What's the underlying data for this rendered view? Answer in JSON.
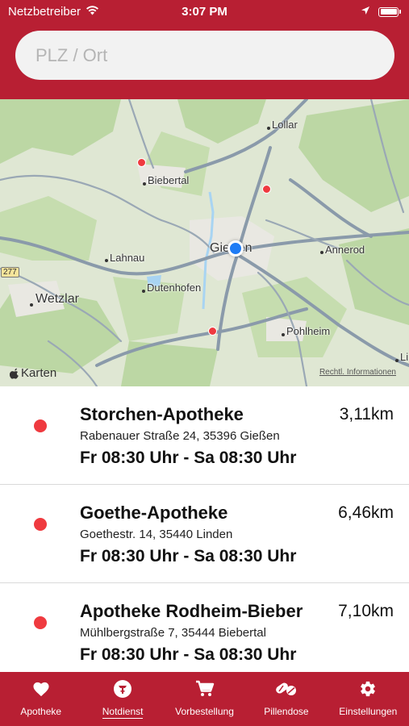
{
  "status_bar": {
    "carrier": "Netzbetreiber",
    "time": "3:07 PM"
  },
  "search": {
    "placeholder": "PLZ / Ort",
    "value": ""
  },
  "map": {
    "labels": {
      "lollar": "Lollar",
      "biebertal": "Biebertal",
      "giessen": "Gießen",
      "annerod": "Annerod",
      "lahnau": "Lahnau",
      "dutenhofen": "Dutenhofen",
      "wetzlar": "Wetzlar",
      "pohlheim": "Pohlheim",
      "li": "Li"
    },
    "road_badge": "277",
    "attribution": "Karten",
    "legal": "Rechtl. Informationen"
  },
  "pharmacies": [
    {
      "name": "Storchen-Apotheke",
      "address": "Rabenauer Straße 24, 35396 Gießen",
      "hours": "Fr 08:30 Uhr - Sa 08:30 Uhr",
      "distance": "3,11km"
    },
    {
      "name": "Goethe-Apotheke",
      "address": "Goethestr. 14, 35440 Linden",
      "hours": "Fr 08:30 Uhr - Sa 08:30 Uhr",
      "distance": "6,46km"
    },
    {
      "name": "Apotheke Rodheim-Bieber",
      "address": "Mühlbergstraße 7, 35444 Biebertal",
      "hours": "Fr 08:30 Uhr - Sa 08:30 Uhr",
      "distance": "7,10km"
    }
  ],
  "tabs": [
    {
      "label": "Apotheke",
      "icon": "heart-icon"
    },
    {
      "label": "Notdienst",
      "icon": "emergency-icon",
      "active": true
    },
    {
      "label": "Vorbestellung",
      "icon": "cart-icon"
    },
    {
      "label": "Pillendose",
      "icon": "pills-icon"
    },
    {
      "label": "Einstellungen",
      "icon": "gear-icon"
    }
  ],
  "colors": {
    "brand": "#b81f33",
    "pin": "#ef3a3f",
    "location": "#1f7cf5"
  }
}
